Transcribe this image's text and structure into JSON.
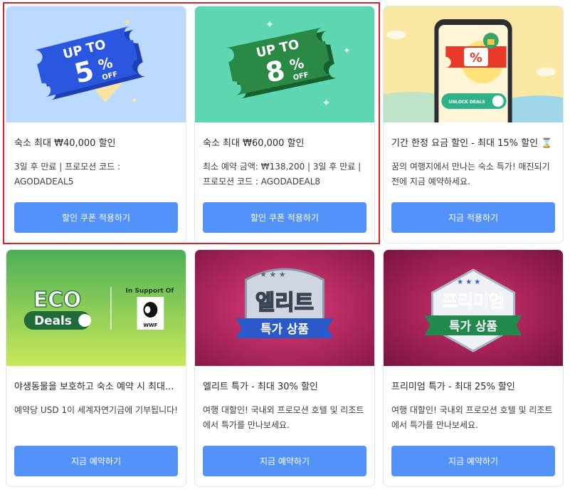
{
  "cards": [
    {
      "art": {
        "name": "ticket-5-percent-art",
        "headline": "UP TO",
        "value": "5",
        "unit": "%",
        "suffix": "OFF",
        "bg": "#bcd9ff",
        "ticket": "#2348c7"
      },
      "title": "숙소 최대 ₩40,000 할인",
      "description": "3일 후 만료 | 프로모션 코드 : AGODADEAL5",
      "button": "할인 쿠폰 적용하기"
    },
    {
      "art": {
        "name": "ticket-8-percent-art",
        "headline": "UP TO",
        "value": "8",
        "unit": "%",
        "suffix": "OFF",
        "bg": "#5fd6b2",
        "ticket": "#1f7a40"
      },
      "title": "숙소 최대 ₩60,000 할인",
      "description": "최소 예약 금액: ₩138,200 | 3일 후 만료 | 프로모션 코드 : AGODADEAL8",
      "button": "할인 쿠폰 적용하기"
    },
    {
      "art": {
        "name": "unlock-deals-phone-art",
        "toggle": "UNLOCK DEALS",
        "symbol": "%",
        "bg": "#fbe7a4"
      },
      "title": "기간 한정 요금 할인 - 최대 15% 할인 ⌛",
      "description": "꿈의 여행지에서 만나는 숙소 특가! 매진되기 전에 지금 예약하세요.",
      "button": "지금 적용하기"
    },
    {
      "art": {
        "name": "eco-deals-art",
        "eco": "ECO",
        "deals": "Deals",
        "support": "In Support Of",
        "wwf": "WWF"
      },
      "title": "야생동물을 보호하고 숙소 예약 시 최대...",
      "description": "예약당 USD 1이 세계자연기금에 기부됩니다!",
      "button": "지금 예약하기"
    },
    {
      "art": {
        "name": "elite-badge-art",
        "line1": "엘리트",
        "line2": "특가 상품"
      },
      "title": "엘리트 특가 - 최대 30% 할인",
      "description": "여행 대할인! 국내외 프로모션 호텔 및 리조트에서 특가를 만나보세요.",
      "button": "지금 예약하기"
    },
    {
      "art": {
        "name": "premium-badge-art",
        "line1": "프리미엄",
        "line2": "특가 상품"
      },
      "title": "프리미엄 특가 - 최대 25% 할인",
      "description": "여행 대할인! 국내외 프로모션 호텔 및 리조트에서 특가를 만나보세요.",
      "button": "지금 예약하기"
    }
  ],
  "colors": {
    "button": "#5392f9",
    "highlight": "#d6232a"
  }
}
